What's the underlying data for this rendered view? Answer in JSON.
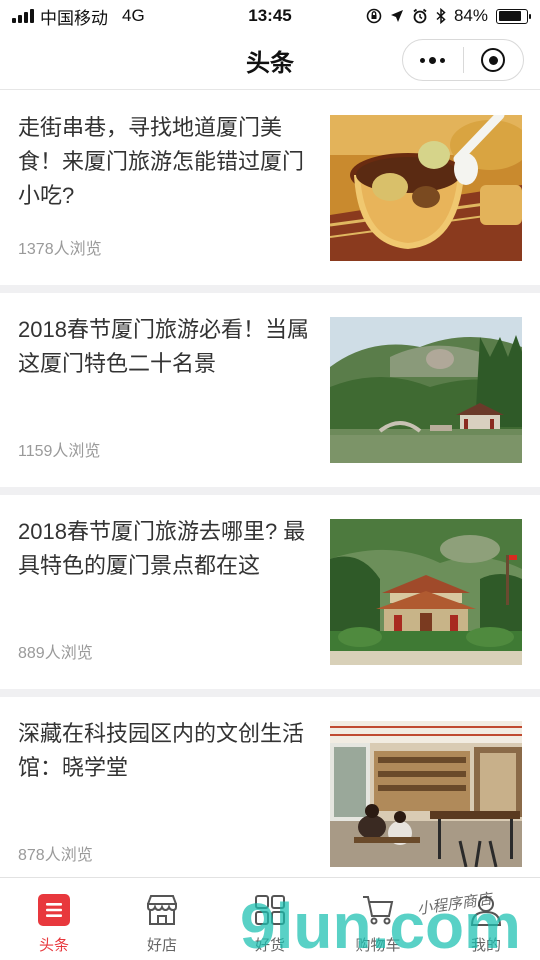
{
  "status_bar": {
    "carrier": "中国移动",
    "network": "4G",
    "time": "13:45",
    "battery_text": "84%",
    "battery_level": 0.84
  },
  "nav": {
    "title": "头条"
  },
  "articles": [
    {
      "title": "走街串巷，寻找地道厦门美食！来厦门旅游怎能错过厦门小吃?",
      "views": "1378人浏览",
      "thumb": "food-bowl"
    },
    {
      "title": "2018春节厦门旅游必看！当属这厦门特色二十名景",
      "views": "1159人浏览",
      "thumb": "lake-pavilion"
    },
    {
      "title": "2018春节厦门旅游去哪里? 最具特色的厦门景点都在这",
      "views": "889人浏览",
      "thumb": "temple"
    },
    {
      "title": "深藏在科技园区内的文创生活馆：晓学堂",
      "views": "878人浏览",
      "thumb": "cafe-interior"
    }
  ],
  "tabs": [
    {
      "label": "头条",
      "icon": "list-icon",
      "active": true
    },
    {
      "label": "好店",
      "icon": "shop-icon",
      "active": false
    },
    {
      "label": "好货",
      "icon": "grid-icon",
      "active": false
    },
    {
      "label": "购物车",
      "icon": "cart-icon",
      "active": false
    },
    {
      "label": "我的",
      "icon": "user-icon",
      "active": false
    }
  ],
  "watermark": {
    "text": "9lun.com",
    "handwriting": "小程序商店"
  },
  "colors": {
    "accent": "#e8383d",
    "divider": "#f0f0f2",
    "views_text": "#9a9a9a",
    "watermark": "#19bfb0"
  }
}
